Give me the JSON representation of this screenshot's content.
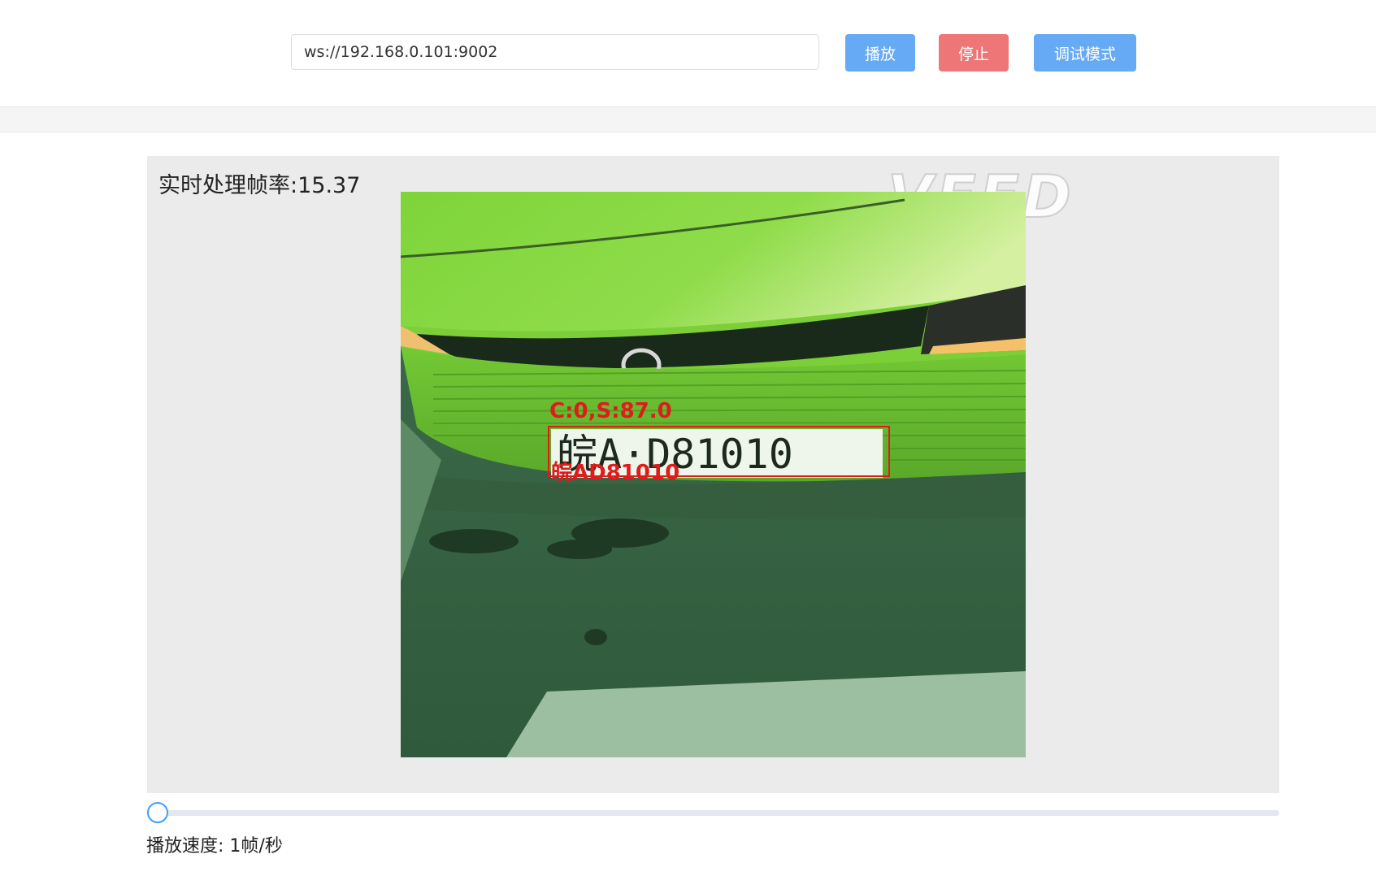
{
  "toolbar": {
    "url_value": "ws://192.168.0.101:9002",
    "play_label": "播放",
    "stop_label": "停止",
    "debug_label": "调试模式"
  },
  "video": {
    "fps_label": "实时处理帧率:15.37",
    "watermark": "VEED",
    "detection": {
      "confidence_text": "C:0,S:87.0",
      "plate_text": "皖AD81010",
      "plate_on_car": "皖A·D81010"
    }
  },
  "playback": {
    "speed_label": "播放速度:",
    "speed_value": "1帧/秒",
    "slider_value": 0
  },
  "colors": {
    "primary": "#66a9f5",
    "danger": "#ee7677",
    "detection": "#e01b1b",
    "panel_bg": "#ebebeb"
  }
}
